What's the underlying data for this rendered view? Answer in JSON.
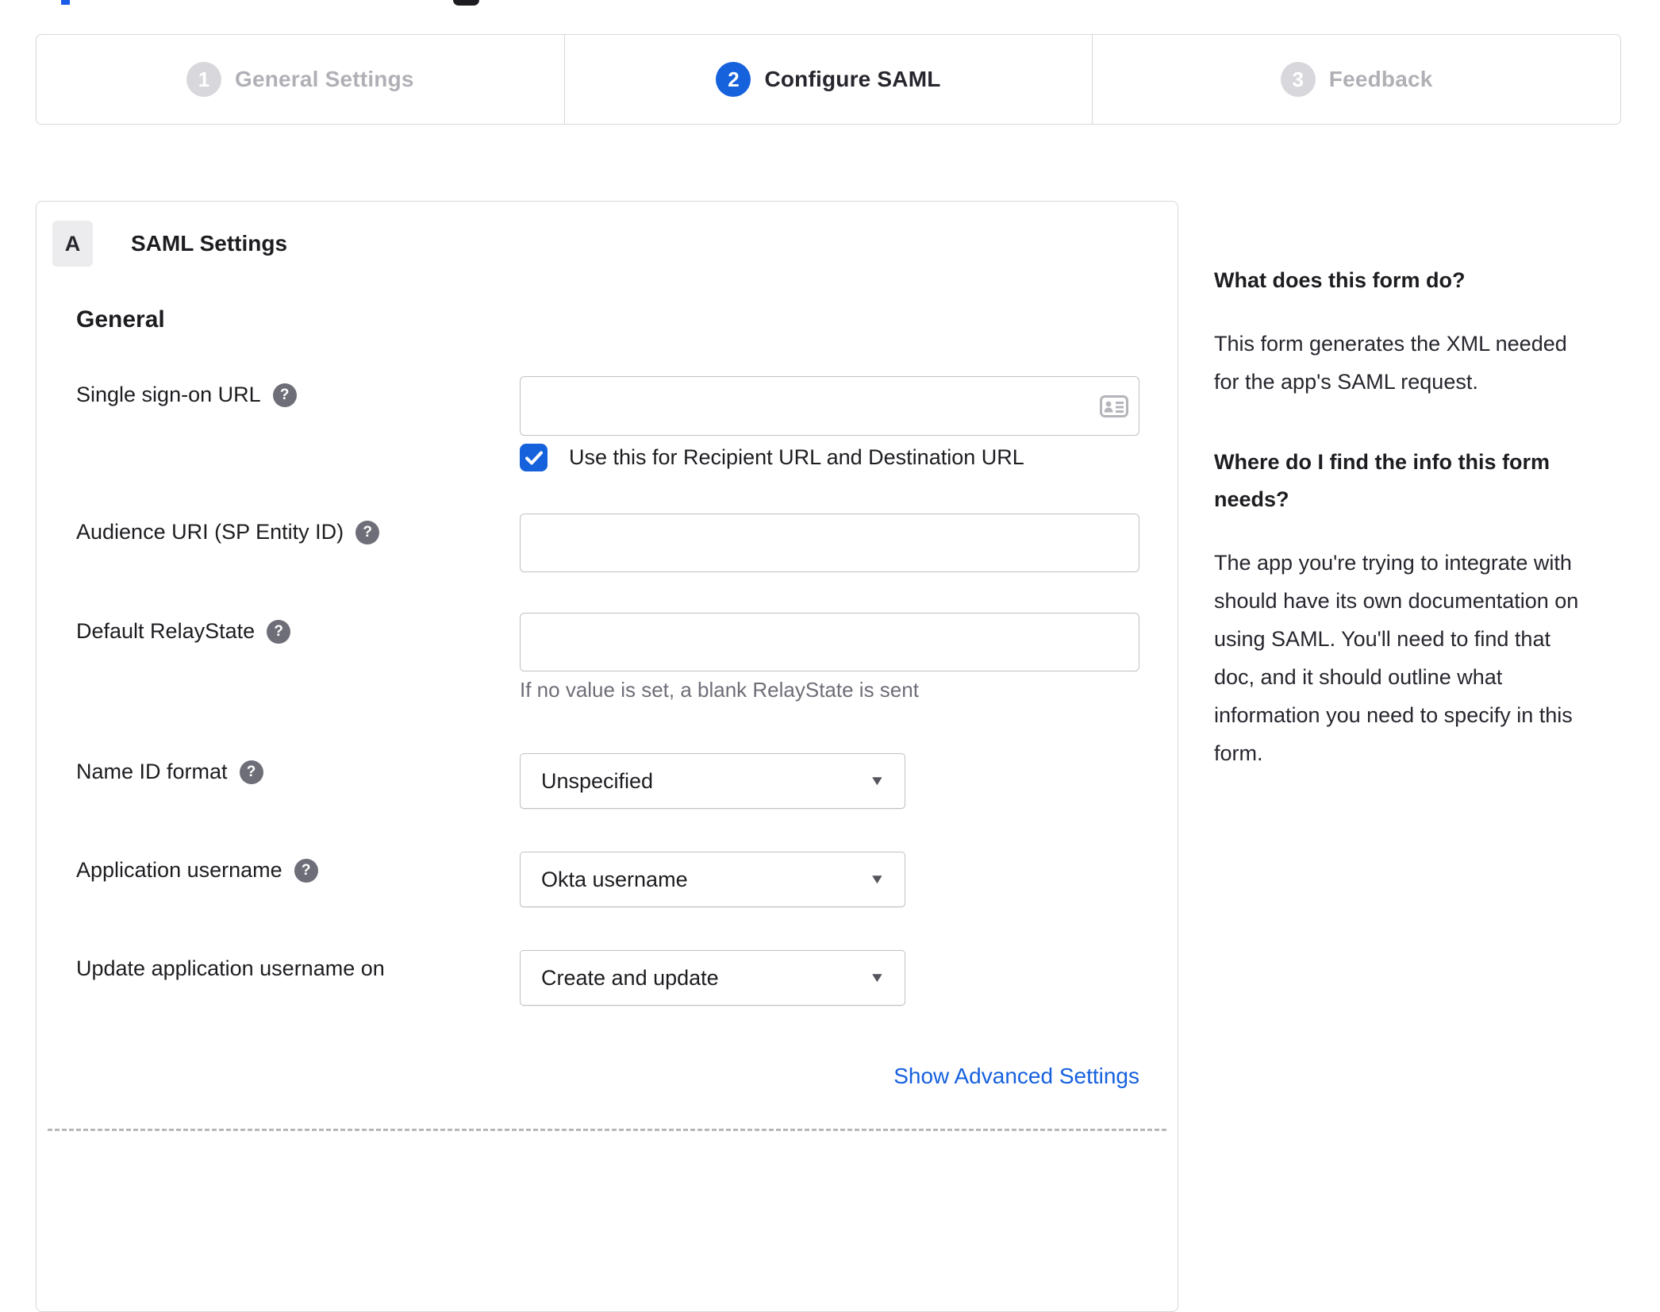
{
  "colors": {
    "accent": "#1662dd",
    "link": "#1661de",
    "inactive_step": "#b0b0b6"
  },
  "stepper": {
    "steps": [
      {
        "number": "1",
        "label": "General Settings",
        "state": "inactive"
      },
      {
        "number": "2",
        "label": "Configure SAML",
        "state": "active"
      },
      {
        "number": "3",
        "label": "Feedback",
        "state": "inactive"
      }
    ]
  },
  "panel": {
    "section_letter": "A",
    "section_title": "SAML Settings",
    "group_title": "General",
    "sso": {
      "label": "Single sign-on URL",
      "value": "",
      "has_help": true
    },
    "sso_checkbox": {
      "label": "Use this for Recipient URL and Destination URL",
      "checked": true
    },
    "audience": {
      "label": "Audience URI (SP Entity ID)",
      "value": "",
      "has_help": true
    },
    "relay": {
      "label": "Default RelayState",
      "value": "",
      "has_help": true,
      "hint": "If no value is set, a blank RelayState is sent"
    },
    "name_id": {
      "label": "Name ID format",
      "value": "Unspecified",
      "has_help": true
    },
    "app_username": {
      "label": "Application username",
      "value": "Okta username",
      "has_help": true
    },
    "update_username": {
      "label": "Update application username on",
      "value": "Create and update",
      "has_help": false
    },
    "advanced_link": "Show Advanced Settings",
    "help_glyph": "?"
  },
  "sidebar": {
    "section1": {
      "heading": "What does this form do?",
      "line1": "This form generates the XML needed",
      "line2": "for the app's SAML request."
    },
    "section2": {
      "heading_line1": "Where do I find the info this form",
      "heading_line2": "needs?",
      "line1": "The app you're trying to integrate with",
      "line2": "should have its own documentation on",
      "line3": "using SAML. You'll need to find that",
      "line4": "doc, and it should outline what",
      "line5": "information you need to specify in this",
      "line6": "form."
    }
  }
}
